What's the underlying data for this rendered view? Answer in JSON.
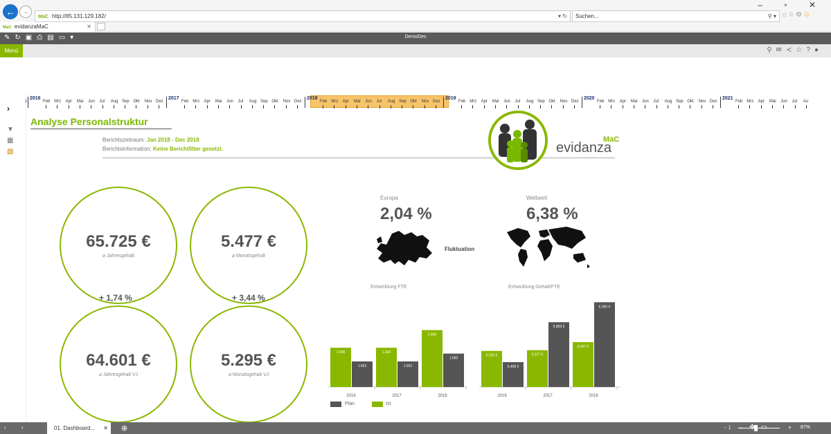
{
  "browser": {
    "url": "http://85.131.129.182/",
    "url_favicon": "MaC",
    "search_placeholder": "Suchen...",
    "tab_title": "evidanzaMaC",
    "tab_favicon": "MaC",
    "window_controls": "–  ▫  ✕"
  },
  "app": {
    "toolbar_title": "DemoDev",
    "menu_label": "Menü"
  },
  "timeline": {
    "years": [
      "2016",
      "2017",
      "2018",
      "2019",
      "2020",
      "2021"
    ],
    "months": [
      "Feb",
      "Mrz",
      "Apr",
      "Mai",
      "Jun",
      "Jul",
      "Aug",
      "Sep",
      "Okt",
      "Nov",
      "Dez"
    ],
    "last_months": [
      "Feb",
      "Mrz",
      "Apr",
      "Mai",
      "Jun",
      "Jul",
      "Au"
    ],
    "selected_year": "2018",
    "leading": "z"
  },
  "report": {
    "title": "Analyse Personalstruktur",
    "period_label": "Berichtszeitraum:",
    "period_value": "Jan 2018 - Dec 2018",
    "info_label": "Berichtsinformation:",
    "info_value": "Keine Berichtfilter gesetzt.",
    "logo_text": "evidanza",
    "logo_suffix": "MaC"
  },
  "kpis": [
    {
      "value": "65.725 €",
      "label": "⌀ Jahresgehalt"
    },
    {
      "value": "5.477 €",
      "label": "⌀ Monatsgehalt"
    },
    {
      "value": "64.601 €",
      "label": "⌀ Jahresgehalt VJ"
    },
    {
      "value": "5.295 €",
      "label": "⌀ Monatsgehalt VJ"
    }
  ],
  "deltas": [
    "+ 1,74 %",
    "+ 3,44 %"
  ],
  "fluctuation": {
    "label": "Fluktuation",
    "europe_label": "Europa",
    "europe_value": "2,04 %",
    "world_label": "Weltweit",
    "world_value": "6,38 %"
  },
  "legend": {
    "plan": "Plan",
    "ist": "Ist"
  },
  "colors": {
    "ist": "#8ab800",
    "plan": "#555555",
    "accent": "#7ab800"
  },
  "chart_data": [
    {
      "type": "bar",
      "title": "Entwicklung FTE",
      "categories": [
        "2016",
        "2017",
        "2018"
      ],
      "series": [
        {
          "name": "Ist",
          "values": [
            1666,
            1666,
            1684
          ],
          "labels": [
            "1.666",
            "1.666",
            "1.684"
          ]
        },
        {
          "name": "Plan",
          "values": [
            1652,
            1652,
            1660
          ],
          "labels": [
            "1.652",
            "1.652",
            "1.660"
          ]
        }
      ]
    },
    {
      "type": "bar",
      "title": "Entwicklung Gehalt/FTE",
      "categories": [
        "2016",
        "2017",
        "2018"
      ],
      "series": [
        {
          "name": "Ist",
          "values": [
            5520,
            5527,
            5607
          ],
          "labels": [
            "5.520 €",
            "5.527 €",
            "5.607 €"
          ]
        },
        {
          "name": "Plan",
          "values": [
            5409,
            5803,
            6000
          ],
          "labels": [
            "5.409 €",
            "5.803 €",
            "6.000 €"
          ]
        }
      ]
    }
  ],
  "bottom": {
    "sheet_tab": "01. Dashboard...",
    "zoom": "87%"
  }
}
